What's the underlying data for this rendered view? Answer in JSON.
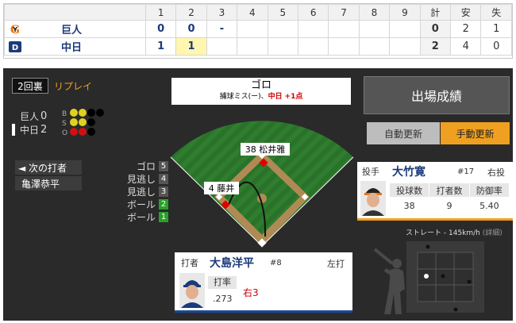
{
  "scoreboard": {
    "innings": [
      "1",
      "2",
      "3",
      "4",
      "5",
      "6",
      "7",
      "8",
      "9"
    ],
    "totals_headers": [
      "計",
      "安",
      "失"
    ],
    "teams": [
      {
        "name": "巨人",
        "scores": [
          "0",
          "0",
          "-",
          "",
          "",
          "",
          "",
          "",
          ""
        ],
        "runs": "0",
        "hits": "2",
        "errors": "1"
      },
      {
        "name": "中日",
        "scores": [
          "1",
          "1",
          "",
          "",
          "",
          "",
          "",
          "",
          ""
        ],
        "runs": "2",
        "hits": "4",
        "errors": "0"
      }
    ]
  },
  "game_state": {
    "inning": "2回裏",
    "replay_label": "リプレイ",
    "teams": [
      {
        "name": "巨人",
        "score": "0",
        "batting": false
      },
      {
        "name": "中日",
        "score": "2",
        "batting": true
      }
    ],
    "bso_labels": [
      "B",
      "S",
      "O"
    ],
    "balls": 2,
    "strikes": 2,
    "outs": 2
  },
  "next_batter": {
    "label": "◄ 次の打者",
    "name": "亀澤恭平"
  },
  "pitch_log": [
    {
      "label": "ゴロ",
      "num": "5",
      "color": "#555555"
    },
    {
      "label": "見逃し",
      "num": "4",
      "color": "#555555"
    },
    {
      "label": "見逃し",
      "num": "3",
      "color": "#555555"
    },
    {
      "label": "ボール",
      "num": "2",
      "color": "#2aa02a"
    },
    {
      "label": "ボール",
      "num": "1",
      "color": "#2aa02a"
    }
  ],
  "play": {
    "title": "ゴロ",
    "detail_prefix": "捕球ミス(ー)、",
    "detail_team": "中日",
    "detail_points": "+1点"
  },
  "field_labels": {
    "fielder_a": "38 松井雅",
    "fielder_b": "4 藤井"
  },
  "buttons": {
    "results": "出場成績",
    "auto_update": "自動更新",
    "manual_update": "手動更新"
  },
  "pitcher": {
    "role": "投手",
    "name": "大竹寛",
    "number": "#17",
    "hand": "右投",
    "headers": [
      "投球数",
      "打者数",
      "防御率"
    ],
    "values": [
      "38",
      "9",
      "5.40"
    ]
  },
  "batter": {
    "role": "打者",
    "name": "大島洋平",
    "number": "#8",
    "hand": "左打",
    "avg_label": "打率",
    "avg": ".273",
    "result": "右3"
  },
  "pitch_info": {
    "text": "ストレート - 145km/h",
    "detail": "(詳細)"
  },
  "colors": {
    "ball": "#e0d020",
    "strike": "#e0d020",
    "out": "#d01010",
    "empty": "#000000",
    "accent_orange": "#f0a020",
    "team_blue": "#1a3a7a"
  }
}
